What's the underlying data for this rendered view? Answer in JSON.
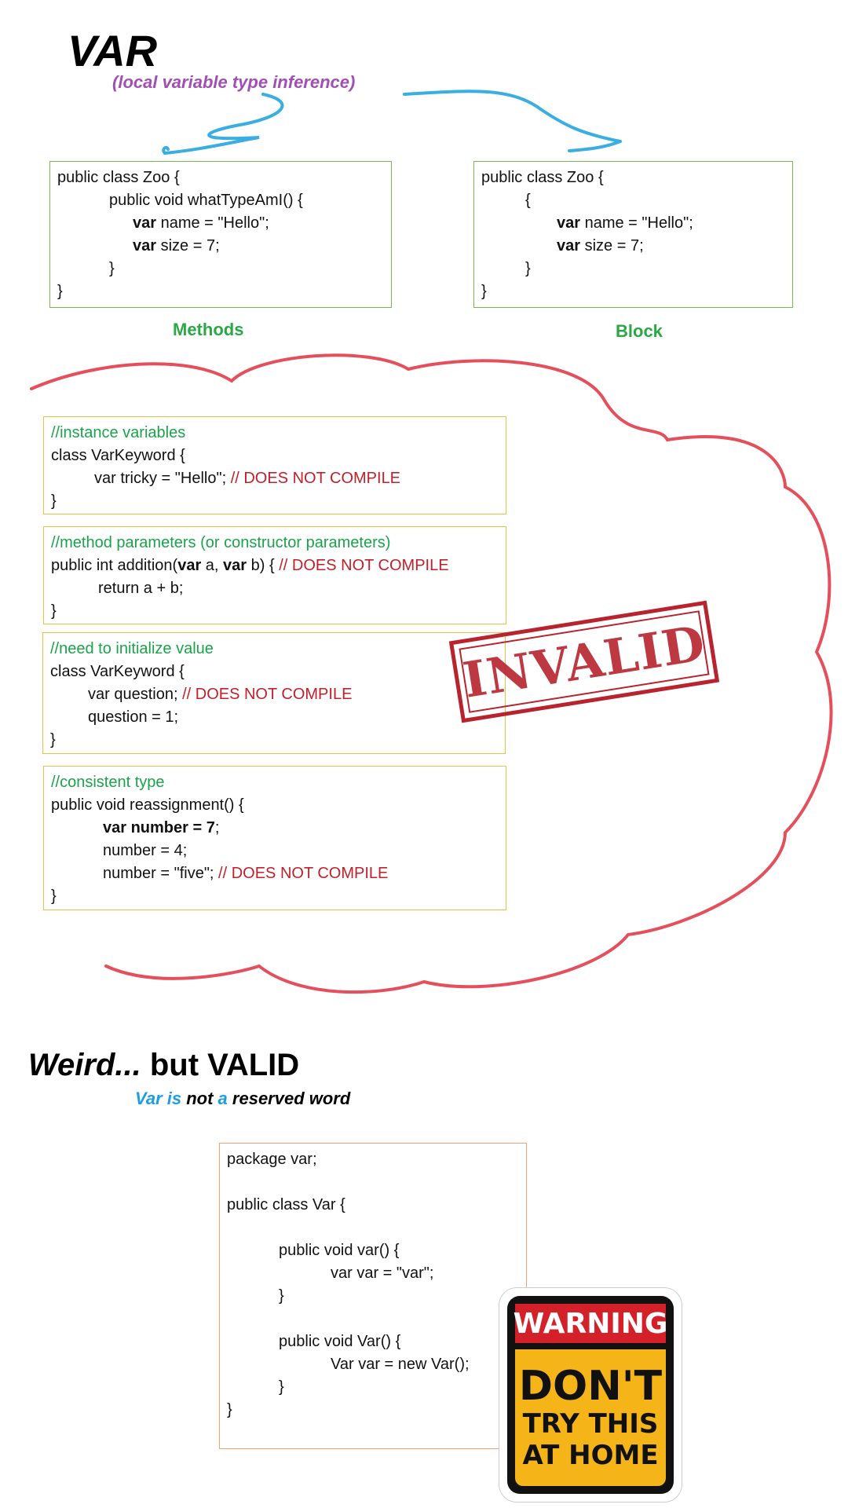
{
  "header": {
    "title": "VAR",
    "subtitle": "(local variable type inference)"
  },
  "top_boxes": {
    "methods": {
      "lines": [
        "public class Zoo {",
        "public void whatTypeAmI() {",
        "name = \"Hello\";",
        "size = 7;",
        "}",
        "}"
      ],
      "keyword": "var",
      "label": "Methods"
    },
    "block": {
      "lines": [
        "public class Zoo {",
        "{",
        "name = \"Hello\";",
        "size = 7;",
        "}",
        "}"
      ],
      "keyword": "var",
      "label": "Block"
    }
  },
  "invalid_examples": [
    {
      "comment": "//instance variables",
      "line1": "class VarKeyword {",
      "line2_code": "var tricky = \"Hello\";",
      "line2_error": "// DOES NOT COMPILE",
      "line3": "}"
    },
    {
      "comment": "//method parameters (or constructor parameters)",
      "line1_a": "public int addition(",
      "line1_kw1": "var",
      "line1_b": " a, ",
      "line1_kw2": "var",
      "line1_c": " b) { ",
      "line1_error": "// DOES NOT COMPILE",
      "line2": "return a + b;",
      "line3": "}"
    },
    {
      "comment": "//need to initialize value",
      "line1": "class VarKeyword {",
      "line2_code": "var question; ",
      "line2_error": "// DOES NOT COMPILE",
      "line3": "question = 1;",
      "line4": "}"
    },
    {
      "comment": "//consistent type",
      "line1": "public void reassignment() {",
      "line2_bold": "var number = 7",
      "line2_rest": ";",
      "line3": "number = 4;",
      "line4_code": "number = \"five\"; ",
      "line4_error": "// DOES NOT COMPILE",
      "line5": "}"
    }
  ],
  "stamp": {
    "text": "INVALID",
    "color": "#b8232e"
  },
  "valid_section": {
    "heading_italic": "Weird...",
    "heading_rest": " but VALID",
    "sub_var": "Var",
    "sub_is": " is ",
    "sub_not": "not",
    "sub_a": " a ",
    "sub_reserved": "reserved word",
    "code": [
      "package var;",
      "",
      "public class Var {",
      "",
      "public void var() {",
      "var var = \"var\";",
      "}",
      "",
      "public void Var() {",
      "Var var = new Var();",
      "}",
      "}"
    ]
  },
  "warning_sign": {
    "top": "WARNING",
    "line1": "DON'T",
    "line2": "TRY THIS",
    "line3": "AT HOME"
  },
  "colors": {
    "accent_purple": "#a050b4",
    "label_green": "#2aa845",
    "error_red": "#c0202a",
    "cloud_red": "#e03040",
    "arrow_blue": "#3aaee0"
  }
}
